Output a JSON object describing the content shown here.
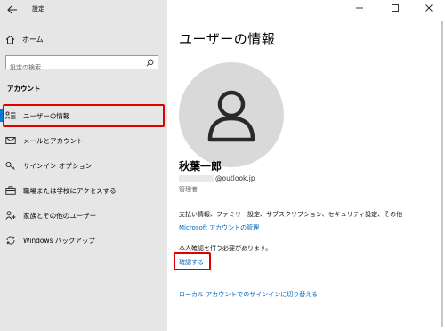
{
  "window": {
    "title": "設定"
  },
  "sidebar": {
    "home_label": "ホーム",
    "search_placeholder": "設定の検索",
    "section_header": "アカウント",
    "items": [
      {
        "label": "ユーザーの情報",
        "icon": "user-info-icon",
        "selected": true
      },
      {
        "label": "メールとアカウント",
        "icon": "mail-icon",
        "selected": false
      },
      {
        "label": "サインイン オプション",
        "icon": "key-icon",
        "selected": false
      },
      {
        "label": "職場または学校にアクセスする",
        "icon": "briefcase-icon",
        "selected": false
      },
      {
        "label": "家族とその他のユーザー",
        "icon": "person-add-icon",
        "selected": false
      },
      {
        "label": "Windows バックアップ",
        "icon": "sync-icon",
        "selected": false
      }
    ]
  },
  "main": {
    "page_title": "ユーザーの情報",
    "user": {
      "name": "秋葉一郎",
      "email_domain": "@outlook.jp",
      "role": "管理者"
    },
    "billing_text": "支払い情報、ファミリー設定、サブスクリプション、セキュリティ設定、その他",
    "ms_account_link": "Microsoft アカウントの管理",
    "verify_prompt": "本人確認を行う必要があります。",
    "verify_link": "確認する",
    "local_account_link": "ローカル アカウントでのサインインに切り替える"
  },
  "colors": {
    "sidebar_bg": "#e6e6e6",
    "accent": "#0078d7",
    "link": "#0067c0",
    "highlight": "#e00000",
    "avatar_bg": "#d9d9d9"
  }
}
